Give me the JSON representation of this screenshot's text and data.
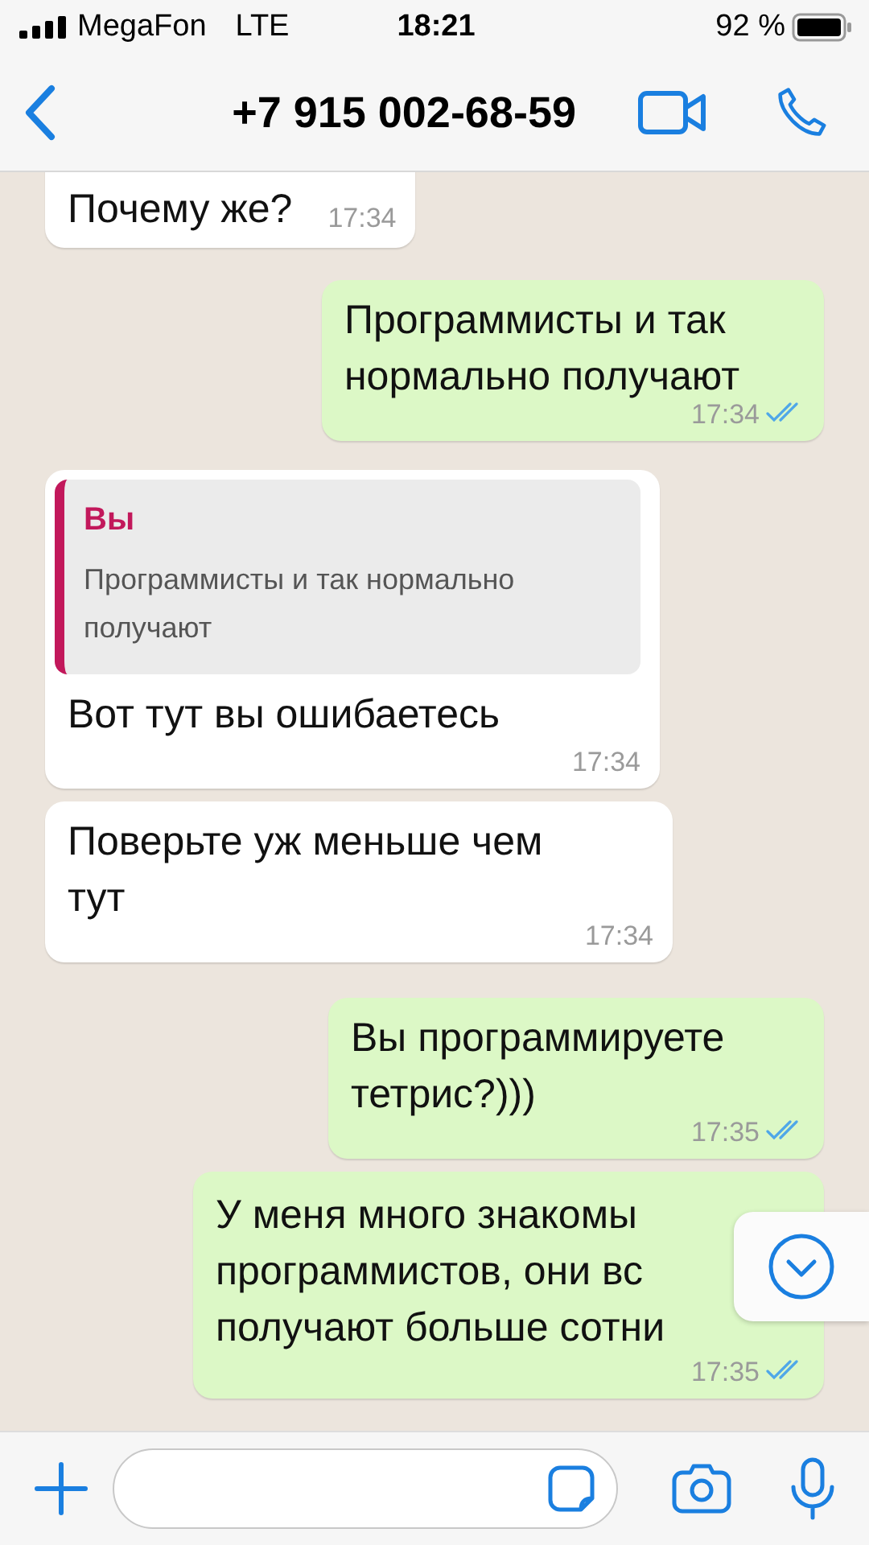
{
  "status_bar": {
    "carrier": "MegaFon",
    "network": "LTE",
    "time": "18:21",
    "battery": "92 %"
  },
  "header": {
    "title": "+7 915 002-68-59"
  },
  "messages": [
    {
      "kind": "incoming",
      "text": "Почему же?",
      "time": "17:34"
    },
    {
      "kind": "outgoing",
      "text": "Программисты и так\nнормально получают",
      "time": "17:34",
      "read": true
    },
    {
      "kind": "incoming",
      "text": "Вот тут вы ошибаетесь",
      "time": "17:34",
      "quote": {
        "author": "Вы",
        "text": "Программисты и так нормально получают"
      }
    },
    {
      "kind": "incoming",
      "text": "Поверьте уж меньше чем\nтут",
      "time": "17:34"
    },
    {
      "kind": "outgoing",
      "text": "Вы программируете\nтетрис?)))",
      "time": "17:35",
      "read": true
    },
    {
      "kind": "outgoing",
      "text": "У меня много знакомы\nпрограммистов, они вс\nполучают больше сотни",
      "time": "17:35",
      "read": true
    }
  ]
}
